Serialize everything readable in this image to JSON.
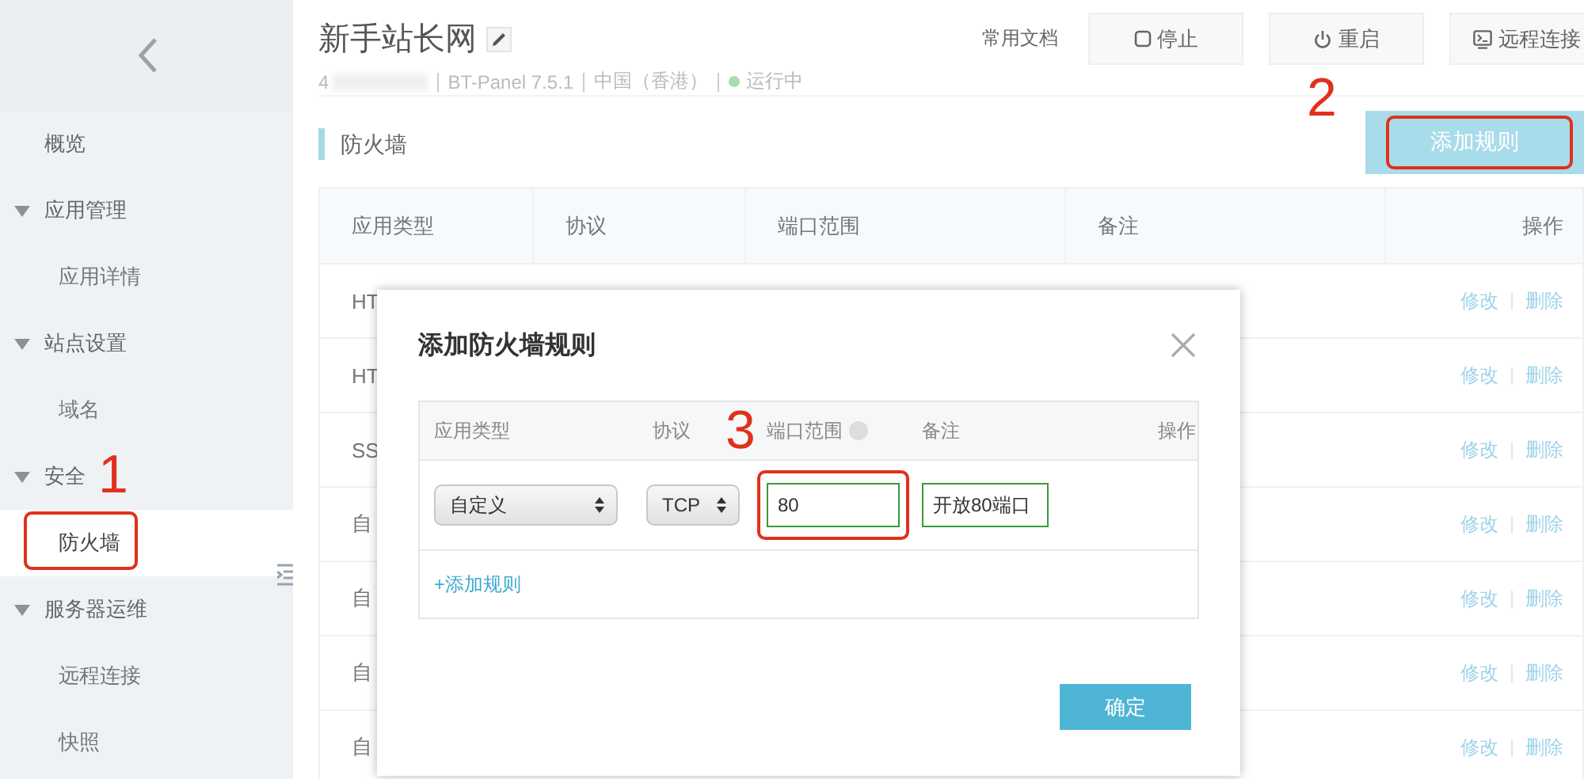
{
  "sidebar": {
    "items": [
      {
        "label": "概览",
        "kind": "link",
        "selected": false
      },
      {
        "label": "应用管理",
        "kind": "group",
        "expanded": true
      },
      {
        "label": "应用详情",
        "kind": "sub",
        "selected": false
      },
      {
        "label": "站点设置",
        "kind": "group",
        "expanded": true
      },
      {
        "label": "域名",
        "kind": "sub",
        "selected": false
      },
      {
        "label": "安全",
        "kind": "group",
        "expanded": true
      },
      {
        "label": "防火墙",
        "kind": "sub",
        "selected": true,
        "callout": "1"
      },
      {
        "label": "服务器运维",
        "kind": "group",
        "expanded": true
      },
      {
        "label": "远程连接",
        "kind": "sub",
        "selected": false
      },
      {
        "label": "快照",
        "kind": "sub",
        "selected": false
      }
    ]
  },
  "header": {
    "title": "新手站长网",
    "ip_visible": "4",
    "version": "BT-Panel 7.5.1",
    "region": "中国（香港）",
    "status": "运行中",
    "running": true,
    "docs_link": "常用文档",
    "buttons": [
      {
        "label": "停止"
      },
      {
        "label": "重启"
      },
      {
        "label": "远程连接"
      }
    ]
  },
  "section": {
    "title": "防火墙",
    "add_button": {
      "label": "添加规则",
      "callout": "2"
    }
  },
  "table": {
    "columns": [
      "应用类型",
      "协议",
      "端口范围",
      "备注",
      "操作"
    ],
    "rows": [
      {
        "type": "HT",
        "edit": "修改",
        "delete": "删除"
      },
      {
        "type": "HT",
        "edit": "修改",
        "delete": "删除"
      },
      {
        "type": "SS",
        "edit": "修改",
        "delete": "删除"
      },
      {
        "type": "自",
        "edit": "修改",
        "delete": "删除"
      },
      {
        "type": "自",
        "edit": "修改",
        "delete": "删除"
      },
      {
        "type": "自",
        "edit": "修改",
        "delete": "删除"
      },
      {
        "type": "自",
        "edit": "修改",
        "delete": "删除"
      }
    ]
  },
  "dialog": {
    "title": "添加防火墙规则",
    "columns": [
      "应用类型",
      "协议",
      "端口范围",
      "备注",
      "操作"
    ],
    "rule": {
      "type": "自定义",
      "protocol": "TCP",
      "port": "80",
      "port_callout": "3",
      "note": "开放80端口"
    },
    "add_link": "+添加规则",
    "confirm": "确定"
  }
}
